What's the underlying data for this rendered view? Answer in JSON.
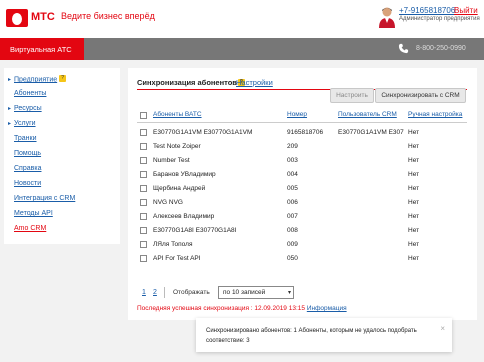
{
  "header": {
    "brand": "МТС",
    "slogan": "Ведите бизнес вперёд",
    "phone": "+7-9165818706",
    "role": "Администратор предприятия",
    "logout": "Выйти"
  },
  "topbar": {
    "active_tab": "Виртуальная АТС",
    "main_phone": "8-800-250-0990"
  },
  "sidebar": {
    "items": [
      {
        "label": "Предприятие",
        "badge": "?"
      },
      {
        "label": "Абоненты"
      },
      {
        "label": "Ресурсы"
      },
      {
        "label": "Услуги"
      },
      {
        "label": "Транки"
      },
      {
        "label": "Помощь"
      },
      {
        "label": "Справка"
      },
      {
        "label": "Новости"
      },
      {
        "label": "Интеграция с CRM"
      },
      {
        "label": "Методы API"
      },
      {
        "label": "Amo CRM"
      }
    ]
  },
  "panel": {
    "title": "Синхронизация абонентов",
    "title_badge": "?",
    "tab_settings": "Настройки",
    "btn_configure": "Настроить",
    "btn_sync": "Синхронизировать с CRM",
    "columns": {
      "subscribers": "Абоненты ВАТС",
      "number": "Номер",
      "crm_user": "Пользователь CRM",
      "manual": "Ручная настройка"
    },
    "rows": [
      {
        "name": "E30770G1A1VM E30770G1A1VM",
        "number": "9165818706",
        "crm_user": "E30770G1A1VM E30770",
        "manual": "Нет"
      },
      {
        "name": "Test Note Zoiper",
        "number": "209",
        "crm_user": "",
        "manual": "Нет"
      },
      {
        "name": "Number Test",
        "number": "003",
        "crm_user": "",
        "manual": "Нет"
      },
      {
        "name": "Баранов УВладимир",
        "number": "004",
        "crm_user": "",
        "manual": "Нет"
      },
      {
        "name": "Щербина Андрей",
        "number": "005",
        "crm_user": "",
        "manual": "Нет"
      },
      {
        "name": "NVG NVG",
        "number": "006",
        "crm_user": "",
        "manual": "Нет"
      },
      {
        "name": "Алексеев Владимир",
        "number": "007",
        "crm_user": "",
        "manual": "Нет"
      },
      {
        "name": "E30770G1A8I E30770G1A8I",
        "number": "008",
        "crm_user": "",
        "manual": "Нет"
      },
      {
        "name": "ЛЯля Тополя",
        "number": "009",
        "crm_user": "",
        "manual": "Нет"
      },
      {
        "name": "API For Test API",
        "number": "050",
        "crm_user": "",
        "manual": "Нет"
      }
    ],
    "pages": [
      "1",
      "2"
    ],
    "show_label": "Отображать",
    "show_value": "по 10 записей",
    "last_sync_text": "Последняя успешная синхронизация : 12.09.2019 13:15",
    "info_link": "Информация"
  },
  "toast": {
    "text": "Синхронизировано абонентов: 1 Абоненты, которым не удалось подобрать соответствие: 3",
    "close": "×"
  },
  "colors": {
    "brand_red": "#e30611",
    "link_blue": "#1a5da8",
    "topbar_gray": "#777777"
  }
}
